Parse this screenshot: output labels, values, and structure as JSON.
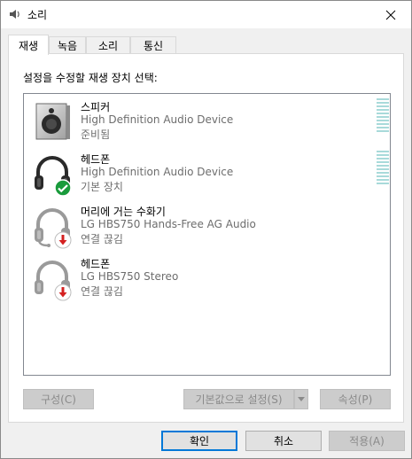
{
  "window": {
    "title": "소리"
  },
  "tabs": [
    {
      "label": "재생",
      "active": true
    },
    {
      "label": "녹음",
      "active": false
    },
    {
      "label": "소리",
      "active": false
    },
    {
      "label": "통신",
      "active": false
    }
  ],
  "playback": {
    "prompt": "설정을 수정할 재생 장치 선택:",
    "devices": [
      {
        "name": "스피커",
        "description": "High Definition Audio Device",
        "status": "준비됨",
        "icon": "speaker-icon",
        "badge": ""
      },
      {
        "name": "헤드폰",
        "description": "High Definition Audio Device",
        "status": "기본 장치",
        "icon": "headphones-icon",
        "badge": "default-check"
      },
      {
        "name": "머리에 거는 수화기",
        "description": "LG HBS750 Hands-Free AG Audio",
        "status": "연결 끊김",
        "icon": "headset-icon",
        "badge": "disconnected-arrow"
      },
      {
        "name": "헤드폰",
        "description": "LG HBS750 Stereo",
        "status": "연결 끊김",
        "icon": "headphones-icon",
        "badge": "disconnected-arrow"
      }
    ],
    "buttons": {
      "configure": "구성(C)",
      "set_default": "기본값으로 설정(S)",
      "properties": "속성(P)"
    }
  },
  "footer": {
    "ok": "확인",
    "cancel": "취소",
    "apply": "적용(A)"
  },
  "colors": {
    "accent": "#0078d7",
    "check": "#1a9b3c",
    "disconnect": "#d42020",
    "meter": "#a8dada"
  }
}
